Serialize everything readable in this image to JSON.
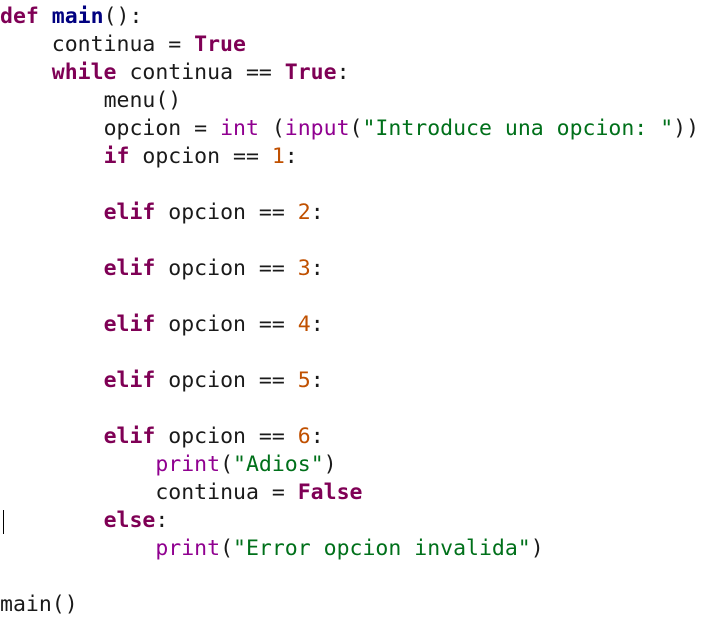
{
  "editor": {
    "language": "python",
    "colors": {
      "keyword": "#7f0055",
      "function_name": "#000080",
      "builtin": "#900090",
      "string": "#00701a",
      "number": "#c05000",
      "text": "#1a1a1a",
      "background": "#ffffff"
    },
    "lines": [
      {
        "indent": "",
        "tokens": [
          {
            "t": "kw",
            "v": "def"
          },
          {
            "t": "plain",
            "v": " "
          },
          {
            "t": "fn",
            "v": "main"
          },
          {
            "t": "plain",
            "v": "():"
          }
        ]
      },
      {
        "indent": "    ",
        "tokens": [
          {
            "t": "plain",
            "v": "continua = "
          },
          {
            "t": "kw",
            "v": "True"
          }
        ]
      },
      {
        "indent": "    ",
        "tokens": [
          {
            "t": "kw",
            "v": "while"
          },
          {
            "t": "plain",
            "v": " continua == "
          },
          {
            "t": "kw",
            "v": "True"
          },
          {
            "t": "plain",
            "v": ":"
          }
        ]
      },
      {
        "indent": "        ",
        "tokens": [
          {
            "t": "plain",
            "v": "menu()"
          }
        ]
      },
      {
        "indent": "        ",
        "tokens": [
          {
            "t": "plain",
            "v": "opcion = "
          },
          {
            "t": "builtin",
            "v": "int"
          },
          {
            "t": "plain",
            "v": " ("
          },
          {
            "t": "builtin",
            "v": "input"
          },
          {
            "t": "plain",
            "v": "("
          },
          {
            "t": "str",
            "v": "\"Introduce una opcion: \""
          },
          {
            "t": "plain",
            "v": "))"
          }
        ]
      },
      {
        "indent": "        ",
        "tokens": [
          {
            "t": "kw",
            "v": "if"
          },
          {
            "t": "plain",
            "v": " opcion == "
          },
          {
            "t": "num",
            "v": "1"
          },
          {
            "t": "plain",
            "v": ":"
          }
        ]
      },
      {
        "indent": "",
        "tokens": []
      },
      {
        "indent": "        ",
        "tokens": [
          {
            "t": "kw",
            "v": "elif"
          },
          {
            "t": "plain",
            "v": " opcion == "
          },
          {
            "t": "num",
            "v": "2"
          },
          {
            "t": "plain",
            "v": ":"
          }
        ]
      },
      {
        "indent": "",
        "tokens": []
      },
      {
        "indent": "        ",
        "tokens": [
          {
            "t": "kw",
            "v": "elif"
          },
          {
            "t": "plain",
            "v": " opcion == "
          },
          {
            "t": "num",
            "v": "3"
          },
          {
            "t": "plain",
            "v": ":"
          }
        ]
      },
      {
        "indent": "",
        "tokens": []
      },
      {
        "indent": "        ",
        "tokens": [
          {
            "t": "kw",
            "v": "elif"
          },
          {
            "t": "plain",
            "v": " opcion == "
          },
          {
            "t": "num",
            "v": "4"
          },
          {
            "t": "plain",
            "v": ":"
          }
        ]
      },
      {
        "indent": "",
        "tokens": []
      },
      {
        "indent": "        ",
        "tokens": [
          {
            "t": "kw",
            "v": "elif"
          },
          {
            "t": "plain",
            "v": " opcion == "
          },
          {
            "t": "num",
            "v": "5"
          },
          {
            "t": "plain",
            "v": ":"
          }
        ]
      },
      {
        "indent": "",
        "tokens": []
      },
      {
        "indent": "        ",
        "tokens": [
          {
            "t": "kw",
            "v": "elif"
          },
          {
            "t": "plain",
            "v": " opcion == "
          },
          {
            "t": "num",
            "v": "6"
          },
          {
            "t": "plain",
            "v": ":"
          }
        ]
      },
      {
        "indent": "            ",
        "tokens": [
          {
            "t": "builtin",
            "v": "print"
          },
          {
            "t": "plain",
            "v": "("
          },
          {
            "t": "str",
            "v": "\"Adios\""
          },
          {
            "t": "plain",
            "v": ")"
          }
        ]
      },
      {
        "indent": "            ",
        "tokens": [
          {
            "t": "plain",
            "v": "continua = "
          },
          {
            "t": "kw",
            "v": "False"
          }
        ]
      },
      {
        "indent": "        ",
        "tokens": [
          {
            "t": "kw",
            "v": "else"
          },
          {
            "t": "plain",
            "v": ":"
          }
        ]
      },
      {
        "indent": "            ",
        "tokens": [
          {
            "t": "builtin",
            "v": "print"
          },
          {
            "t": "plain",
            "v": "("
          },
          {
            "t": "str",
            "v": "\"Error opcion invalida\""
          },
          {
            "t": "plain",
            "v": ")"
          }
        ]
      },
      {
        "indent": "",
        "tokens": []
      },
      {
        "indent": "",
        "tokens": [
          {
            "t": "plain",
            "v": "main()"
          }
        ]
      }
    ]
  }
}
